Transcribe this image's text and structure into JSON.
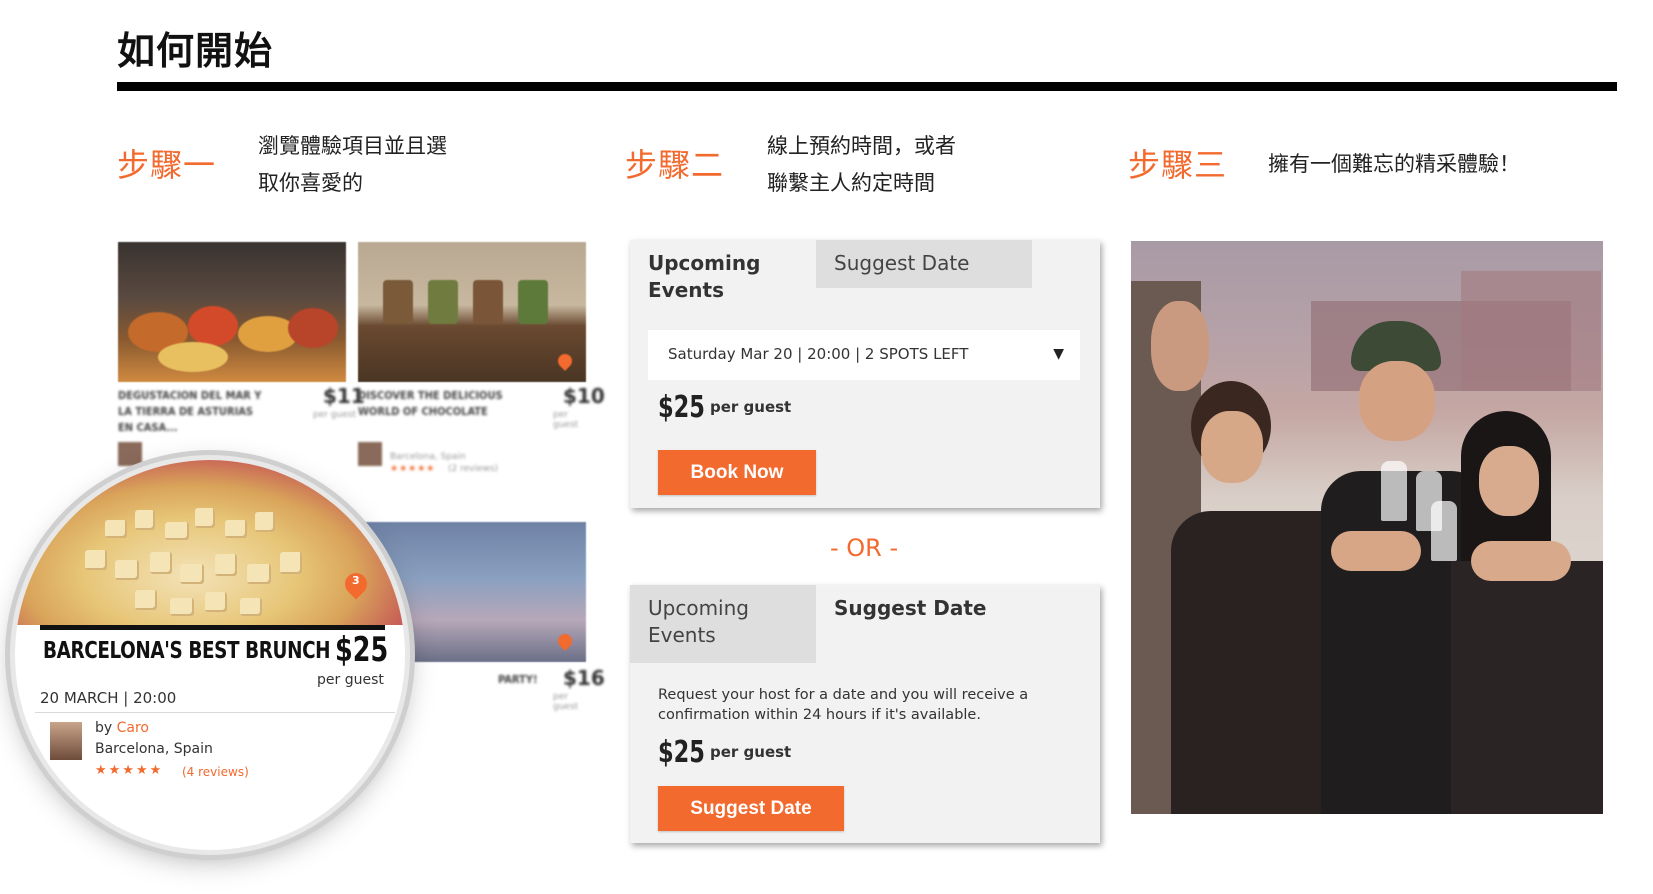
{
  "header": {
    "title": "如何開始"
  },
  "steps": [
    {
      "label": "步驟一",
      "desc_line1": "瀏覽體驗項目並且選",
      "desc_line2": "取你喜愛的"
    },
    {
      "label": "步驟二",
      "desc_line1": "線上預約時間，或者",
      "desc_line2": "聯繫主人約定時間"
    },
    {
      "label": "步驟三",
      "desc_line1": "擁有一個難忘的精采體驗！"
    }
  ],
  "listing": {
    "title": "BARCELONA'S BEST BRUNCH",
    "price": "$25",
    "per_guest": "per guest",
    "date": "20 MARCH  |  20:00",
    "by": "by",
    "host": "Caro",
    "location": "Barcelona, Spain",
    "stars": "★★★★★",
    "reviews": "(4 reviews)",
    "pin_count": "3",
    "blurred": {
      "card_a_title": "DEGUSTACION DEL MAR Y LA TIERRA DE ASTURIAS EN CASA...",
      "card_a_price": "$11",
      "card_b_title": "DISCOVER THE DELICIOUS WORLD OF CHOCOLATE",
      "card_b_price": "$10",
      "card_c_price": "$16",
      "card_c_title": "PARTY!",
      "per_guest": "per guest",
      "card_b_location": "Barcelona, Spain",
      "card_b_reviews": "(2 reviews)"
    }
  },
  "booking": {
    "tab_upcoming": "Upcoming Events",
    "tab_suggest": "Suggest Date",
    "select_value": "Saturday Mar 20 | 20:00 | 2 SPOTS LEFT",
    "select_arrow": "▼",
    "price": "$25",
    "per_guest": "per guest",
    "book_button": "Book Now",
    "or_label": "- OR -",
    "request_text": "Request your host for a date and you will receive a confirmation within 24 hours if it's available.",
    "suggest_button": "Suggest Date"
  },
  "colors": {
    "accent": "#f26a2e",
    "rule": "#000000",
    "widget_bg": "#f2f2f2",
    "tab_inactive": "#dedede"
  }
}
